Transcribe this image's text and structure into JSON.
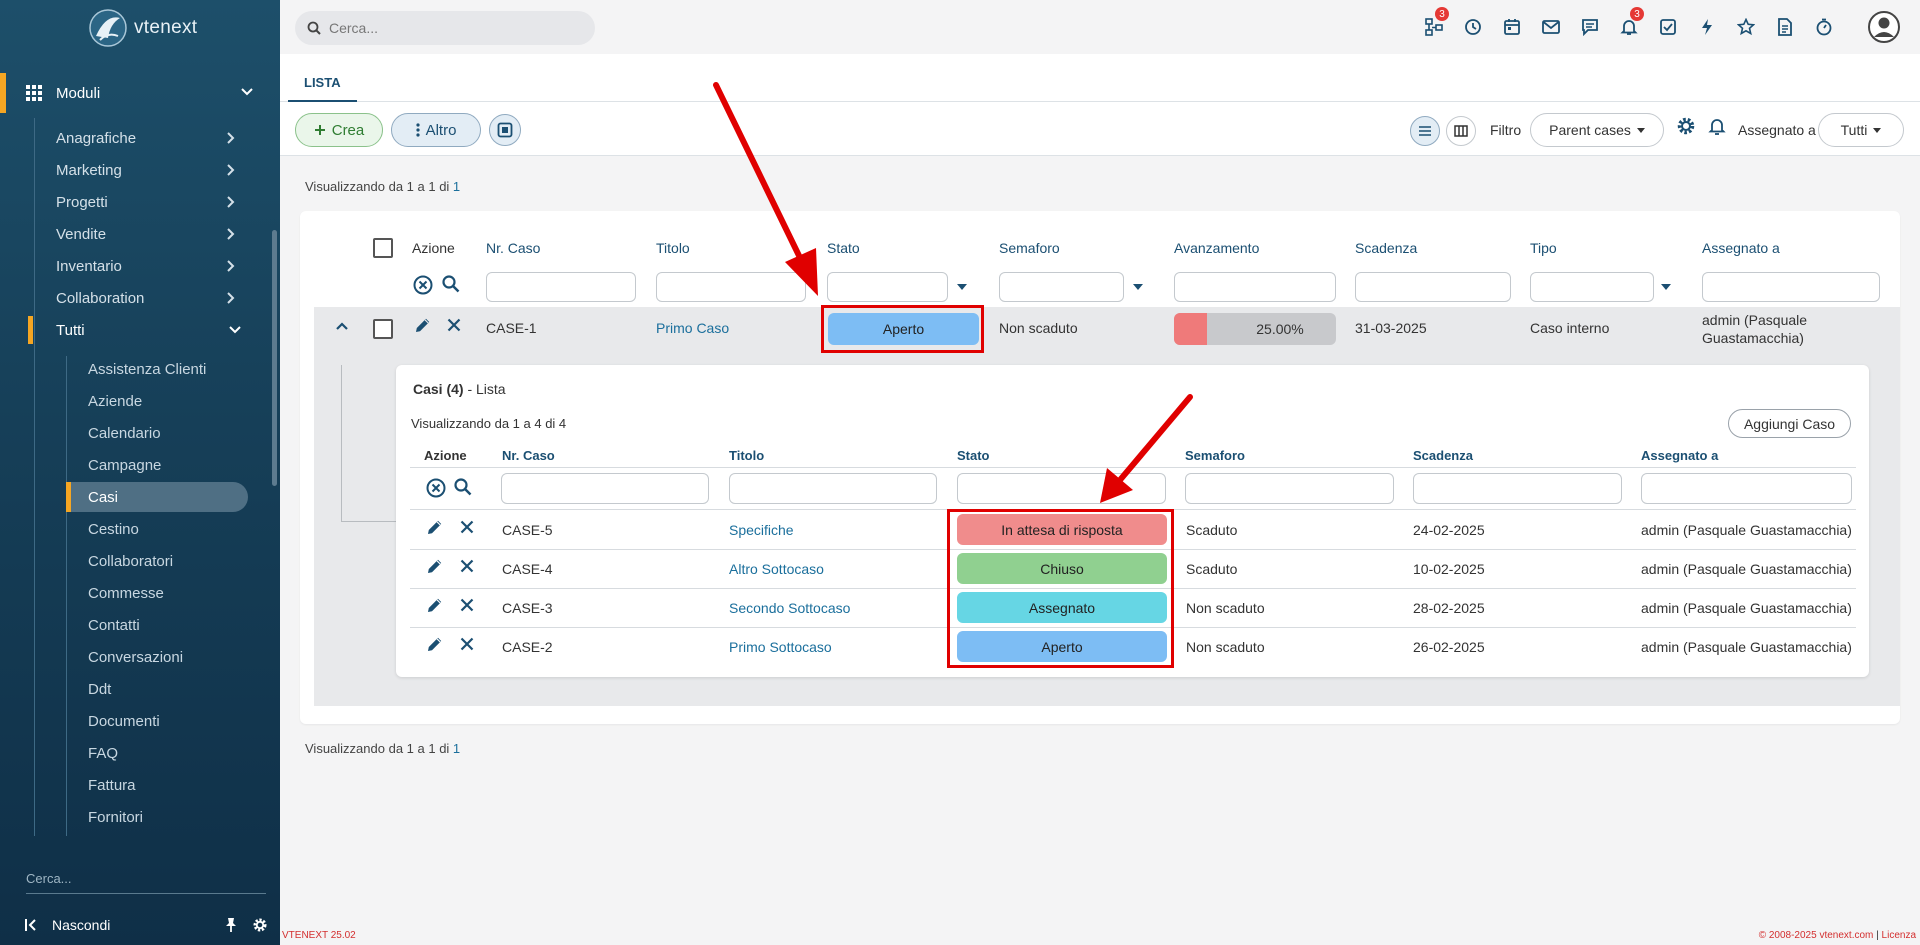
{
  "app": {
    "logo_text": "vtenext",
    "version": "VTENEXT 25.02",
    "copyright": "© 2008-2025 vtenext.com",
    "license_sep": " | ",
    "license": "Licenza"
  },
  "sidebar": {
    "moduli": "Moduli",
    "groups": [
      "Anagrafiche",
      "Marketing",
      "Progetti",
      "Vendite",
      "Inventario",
      "Collaboration"
    ],
    "tutti": "Tutti",
    "items": [
      "Assistenza Clienti",
      "Aziende",
      "Calendario",
      "Campagne",
      "Casi",
      "Cestino",
      "Collaboratori",
      "Commesse",
      "Contatti",
      "Conversazioni",
      "Ddt",
      "Documenti",
      "FAQ",
      "Fattura",
      "Fornitori"
    ],
    "active_item": "Casi",
    "search_placeholder": "Cerca...",
    "hide_label": "Nascondi"
  },
  "topbar": {
    "search_placeholder": "Cerca...",
    "icons": [
      "process-icon",
      "history-icon",
      "calendar-icon",
      "mail-icon",
      "chat-icon",
      "notification-bell-icon",
      "tasks-icon",
      "quick-action-icon",
      "favorites-icon",
      "document-icon",
      "timer-icon"
    ],
    "process_badge": "3",
    "notification_badge": "3"
  },
  "tabs": {
    "lista": "LISTA"
  },
  "toolbar": {
    "crea": "Crea",
    "altro": "Altro",
    "filtro_label": "Filtro",
    "filtro_value": "Parent cases",
    "assegnato_label": "Assegnato a",
    "assegnato_value": "Tutti"
  },
  "list": {
    "count_prefix": "Visualizzando da 1 a 1 di ",
    "count_total": "1",
    "headers": {
      "azione": "Azione",
      "nr_caso": "Nr. Caso",
      "titolo": "Titolo",
      "stato": "Stato",
      "semaforo": "Semaforo",
      "avanzamento": "Avanzamento",
      "scadenza": "Scadenza",
      "tipo": "Tipo",
      "assegnato": "Assegnato a"
    },
    "row": {
      "nr_caso": "CASE-1",
      "titolo": "Primo Caso",
      "stato": "Aperto",
      "semaforo": "Non scaduto",
      "avanzamento": "25.00%",
      "avanzamento_fraction": 0.25,
      "scadenza": "31-03-2025",
      "tipo": "Caso interno",
      "assegnato_line1": "admin (Pasquale",
      "assegnato_line2": "Guastamacchia)"
    }
  },
  "subpanel": {
    "title_bold": "Casi (4)",
    "title_rest": " - Lista",
    "count": "Visualizzando da 1 a 4 di 4",
    "add_button": "Aggiungi Caso",
    "headers": {
      "azione": "Azione",
      "nr_caso": "Nr. Caso",
      "titolo": "Titolo",
      "stato": "Stato",
      "semaforo": "Semaforo",
      "scadenza": "Scadenza",
      "assegnato": "Assegnato a"
    },
    "rows": [
      {
        "nr": "CASE-5",
        "titolo": "Specifiche",
        "stato": "In attesa di risposta",
        "stato_color": "#f08c8c",
        "semaforo": "Scaduto",
        "scadenza": "24-02-2025",
        "assegnato": "admin (Pasquale Guastamacchia)"
      },
      {
        "nr": "CASE-4",
        "titolo": "Altro Sottocaso",
        "stato": "Chiuso",
        "stato_color": "#90d090",
        "semaforo": "Scaduto",
        "scadenza": "10-02-2025",
        "assegnato": "admin (Pasquale Guastamacchia)"
      },
      {
        "nr": "CASE-3",
        "titolo": "Secondo Sottocaso",
        "stato": "Assegnato",
        "stato_color": "#66d6e4",
        "semaforo": "Non scaduto",
        "scadenza": "28-02-2025",
        "assegnato": "admin (Pasquale Guastamacchia)"
      },
      {
        "nr": "CASE-2",
        "titolo": "Primo Sottocaso",
        "stato": "Aperto",
        "stato_color": "#7dbdf4",
        "semaforo": "Non scaduto",
        "scadenza": "26-02-2025",
        "assegnato": "admin (Pasquale Guastamacchia)"
      }
    ]
  },
  "colors": {
    "stato_aperto": "#7dbdf4",
    "highlight_red": "#e00000",
    "progress_fill": "#ef7a7a",
    "accent_orange": "#f5a623",
    "sidebar_bg": "#1d4f6a"
  }
}
